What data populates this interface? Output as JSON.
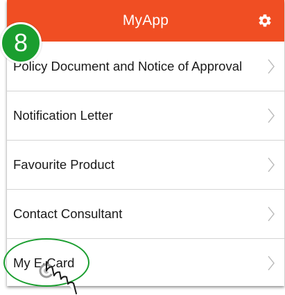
{
  "colors": {
    "header_bg": "#f04e23",
    "annotation_green": "#1a9e2f",
    "chevron": "#b8b8b8"
  },
  "app": {
    "title": "MyApp",
    "settings_icon": "gear-icon"
  },
  "annotation": {
    "step_number": "8",
    "cursor_icon": "hand-pointer-icon"
  },
  "menu": {
    "items": [
      {
        "label": "Policy Document and Notice of Approval",
        "icon": "chevron-right-icon"
      },
      {
        "label": "Notification Letter",
        "icon": "chevron-right-icon"
      },
      {
        "label": "Favourite Product",
        "icon": "chevron-right-icon"
      },
      {
        "label": "Contact Consultant",
        "icon": "chevron-right-icon"
      },
      {
        "label": "My E-Card",
        "icon": "chevron-right-icon"
      }
    ]
  }
}
